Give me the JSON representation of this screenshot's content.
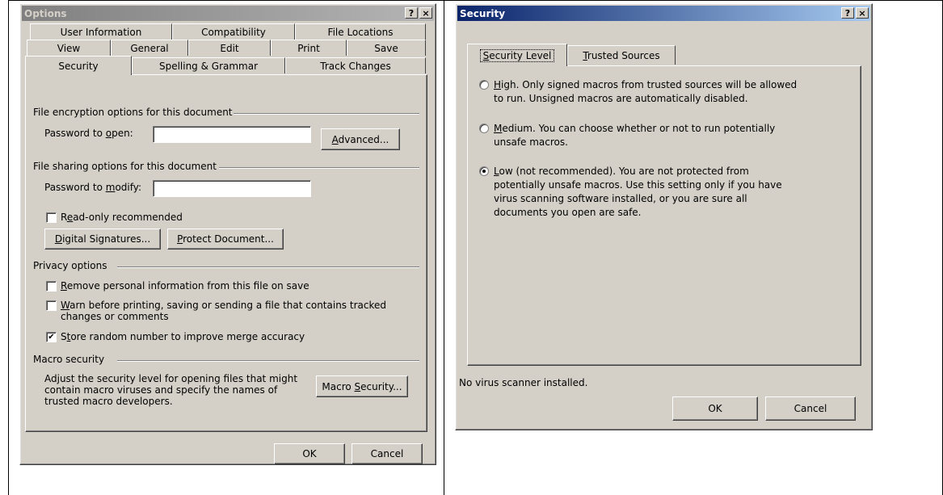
{
  "options": {
    "title": "Options",
    "help_btn": "?",
    "close_btn": "×",
    "tabs_row1": [
      "User Information",
      "Compatibility",
      "File Locations"
    ],
    "tabs_row2": [
      "View",
      "General",
      "Edit",
      "Print",
      "Save"
    ],
    "tabs_row3": [
      "Security",
      "Spelling & Grammar",
      "Track Changes"
    ],
    "encryption": {
      "group": "File encryption options for this document",
      "pwd_open_pre": "Password to ",
      "pwd_open_u": "o",
      "pwd_open_post": "pen:",
      "pwd_open_value": "",
      "advanced_u": "A",
      "advanced_post": "dvanced..."
    },
    "sharing": {
      "group": "File sharing options for this document",
      "pwd_modify_pre": "Password to ",
      "pwd_modify_u": "m",
      "pwd_modify_post": "odify:",
      "pwd_modify_value": "",
      "readonly_pre": "R",
      "readonly_u": "e",
      "readonly_post": "ad-only recommended",
      "readonly_checked": false,
      "digsig_u": "D",
      "digsig_post": "igital Signatures...",
      "protect_u": "P",
      "protect_post": "rotect Document..."
    },
    "privacy": {
      "group": "Privacy options",
      "remove_u": "R",
      "remove_post": "emove personal information from this file on save",
      "remove_checked": false,
      "warn_u": "W",
      "warn_post": "arn before printing, saving or sending a file that contains tracked",
      "warn_line2": "changes or comments",
      "warn_checked": false,
      "store_pre": "S",
      "store_u": "t",
      "store_post": "ore random number to improve merge accuracy",
      "store_checked": true
    },
    "macro": {
      "group": "Macro security",
      "desc_line1": "Adjust the security level for opening files that might",
      "desc_line2": "contain macro viruses and specify the names of",
      "desc_line3": "trusted macro developers.",
      "btn_pre": "Macro ",
      "btn_u": "S",
      "btn_post": "ecurity..."
    },
    "ok": "OK",
    "cancel": "Cancel"
  },
  "security": {
    "title": "Security",
    "help_btn": "?",
    "close_btn": "×",
    "tab1_u": "S",
    "tab1_post": "ecurity Level",
    "tab2_u": "T",
    "tab2_post": "rusted Sources",
    "high_u": "H",
    "high_line1": "igh. Only signed macros from trusted sources will be allowed",
    "high_line2": "to run. Unsigned macros are automatically disabled.",
    "medium_u": "M",
    "medium_line1": "edium. You can choose whether or not to run potentially",
    "medium_line2": "unsafe macros.",
    "low_u": "L",
    "low_line1": "ow (not recommended). You are not protected from",
    "low_line2": "potentially unsafe macros. Use this setting only if you have",
    "low_line3": "virus scanning software installed, or you are sure all",
    "low_line4": "documents you open are safe.",
    "selected": "low",
    "status": "No virus scanner installed.",
    "ok": "OK",
    "cancel": "Cancel"
  }
}
